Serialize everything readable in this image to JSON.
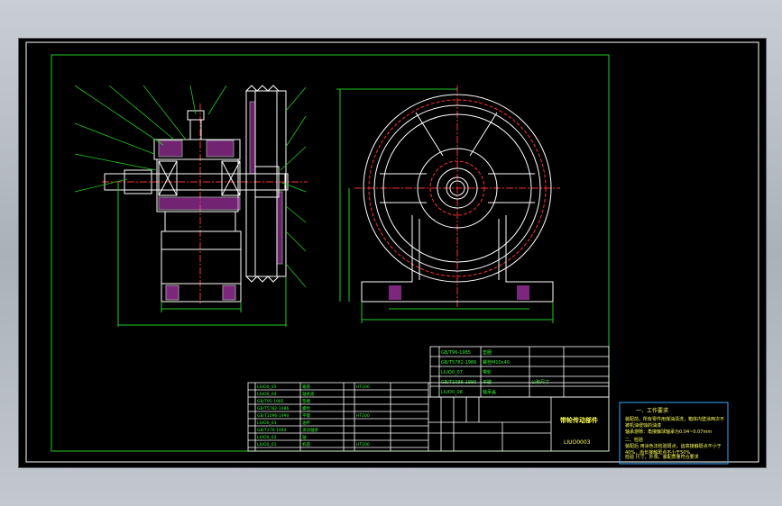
{
  "title_block": {
    "drawing_title": "带轮传动部件",
    "drawing_number": "LIUO0003"
  },
  "tech_notes": {
    "heading": "一、工作要求",
    "lines": [
      "装配前，所有零件用煤油清洗，箱体内壁涂两次不被机油侵蚀的油漆",
      "轴承游隙：角接触球轴承为0.04~0.07mm",
      "二、检验",
      "装配后 用涂色法检验斑点，齿高接触斑点不小于40%，齿长接触斑点不小于50%",
      "检验 尺寸、外观、装配质量符合要求"
    ]
  },
  "colors": {
    "background": "#000000",
    "frame": "#ffffff",
    "inner_border": "#22cc22",
    "part_lines": "#ffffff",
    "hatch": "#d040d0",
    "centerline": "#ff3030",
    "dimension": "#22cc22",
    "table_text": "#33ee33",
    "yellow_text": "#ffff55",
    "note_box": "#33aaff"
  }
}
